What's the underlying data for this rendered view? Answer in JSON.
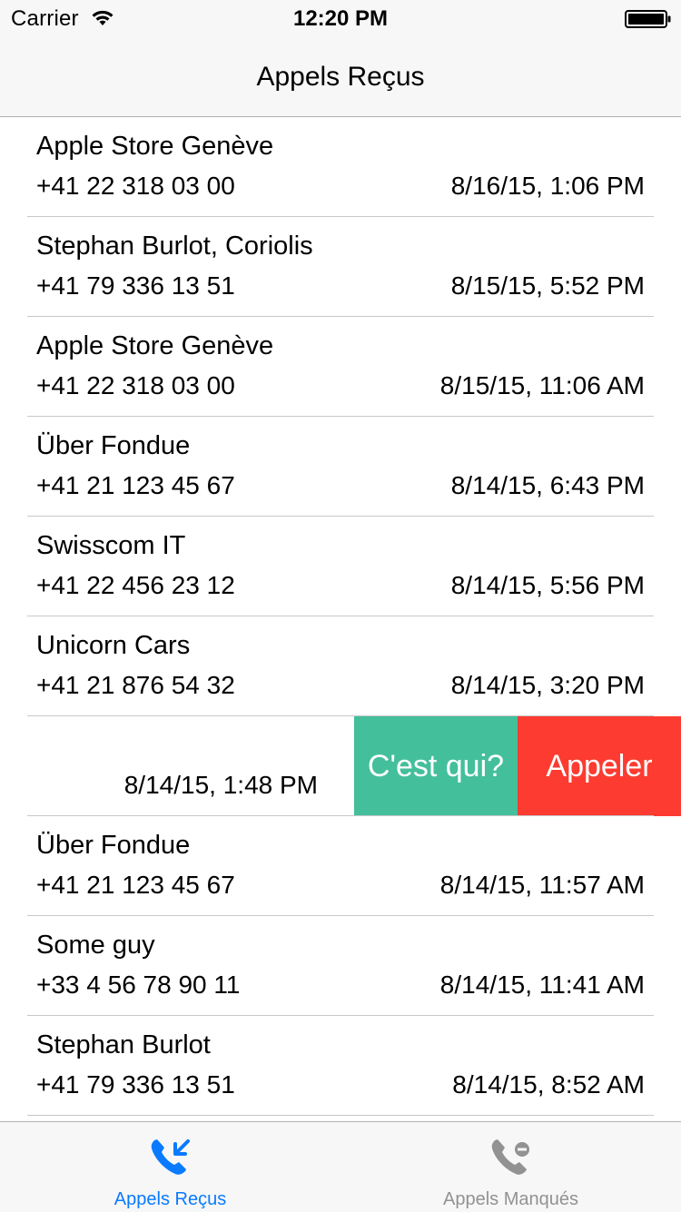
{
  "status_bar": {
    "carrier": "Carrier",
    "time": "12:20 PM"
  },
  "nav": {
    "title": "Appels Reçus"
  },
  "calls": [
    {
      "name": "Apple Store Genève",
      "phone": "+41 22 318 03 00",
      "date": "8/16/15, 1:06 PM"
    },
    {
      "name": "Stephan Burlot, Coriolis",
      "phone": "+41 79 336 13 51",
      "date": "8/15/15, 5:52 PM"
    },
    {
      "name": "Apple Store Genève",
      "phone": "+41 22 318 03 00",
      "date": "8/15/15, 11:06 AM"
    },
    {
      "name": "Über Fondue",
      "phone": "+41 21 123 45 67",
      "date": "8/14/15, 6:43 PM"
    },
    {
      "name": "Swisscom IT",
      "phone": "+41 22 456 23 12",
      "date": "8/14/15, 5:56 PM"
    },
    {
      "name": "Unicorn Cars",
      "phone": "+41 21 876 54 32",
      "date": "8/14/15, 3:20 PM"
    },
    {
      "name": "",
      "phone": "",
      "date": "8/14/15, 1:48 PM"
    },
    {
      "name": "Über Fondue",
      "phone": "+41 21 123 45 67",
      "date": "8/14/15, 11:57 AM"
    },
    {
      "name": "Some guy",
      "phone": "+33 4 56 78 90 11",
      "date": "8/14/15, 11:41 AM"
    },
    {
      "name": "Stephan Burlot",
      "phone": "+41 79 336 13 51",
      "date": "8/14/15, 8:52 AM"
    }
  ],
  "swipe_actions": {
    "who_label": "C'est qui?",
    "who_color": "#44bf9b",
    "call_label": "Appeler",
    "call_color": "#fd3b30"
  },
  "tabs": [
    {
      "label": "Appels Reçus",
      "icon": "incoming-call-icon",
      "active": true
    },
    {
      "label": "Appels Manqués",
      "icon": "missed-call-icon",
      "active": false
    }
  ],
  "colors": {
    "tint": "#0a7aff",
    "inactive": "#929292",
    "bar_background": "#f7f7f7"
  }
}
